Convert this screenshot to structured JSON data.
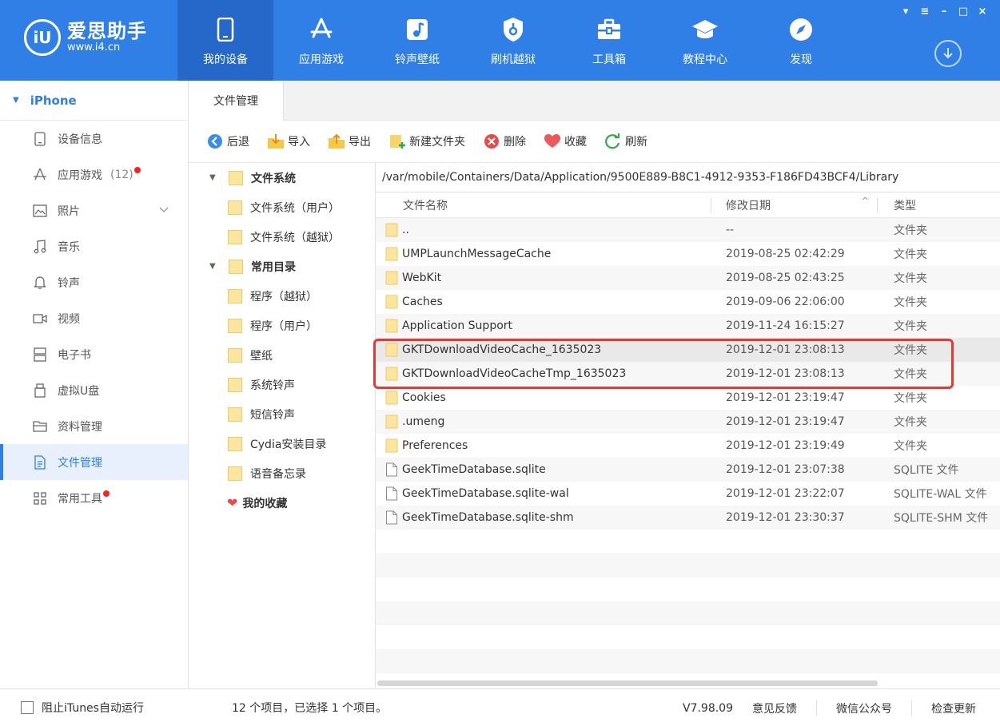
{
  "app": {
    "logo_mark": "iU",
    "name": "爱思助手",
    "url": "www.i4.cn",
    "accent": "#2f7fe6"
  },
  "nav": [
    {
      "label": "我的设备",
      "icon": "phone-icon"
    },
    {
      "label": "应用游戏",
      "icon": "appstore-icon"
    },
    {
      "label": "铃声壁纸",
      "icon": "music-note-icon"
    },
    {
      "label": "刷机越狱",
      "icon": "shield-icon"
    },
    {
      "label": "工具箱",
      "icon": "toolbox-icon"
    },
    {
      "label": "教程中心",
      "icon": "graduation-cap-icon"
    },
    {
      "label": "发现",
      "icon": "compass-icon"
    }
  ],
  "window_controls": [
    "▾",
    "≡",
    "–",
    "□",
    "×"
  ],
  "sidebar": {
    "device": "iPhone",
    "items": [
      {
        "label": "设备信息",
        "icon": "device-info-icon"
      },
      {
        "label": "应用游戏",
        "icon": "appstore-icon",
        "count": "(12)",
        "dot": true
      },
      {
        "label": "照片",
        "icon": "photo-icon",
        "expandable": true
      },
      {
        "label": "音乐",
        "icon": "music-icon"
      },
      {
        "label": "铃声",
        "icon": "bell-icon"
      },
      {
        "label": "视频",
        "icon": "video-icon"
      },
      {
        "label": "电子书",
        "icon": "book-icon"
      },
      {
        "label": "虚拟U盘",
        "icon": "usb-icon"
      },
      {
        "label": "资料管理",
        "icon": "folder-icon"
      },
      {
        "label": "文件管理",
        "icon": "file-icon",
        "active": true
      },
      {
        "label": "常用工具",
        "icon": "grid-icon",
        "dot": true
      }
    ]
  },
  "tab": {
    "label": "文件管理"
  },
  "toolbar": {
    "back": "后退",
    "import": "导入",
    "export": "导出",
    "new_folder": "新建文件夹",
    "delete": "删除",
    "favorite": "收藏",
    "refresh": "刷新"
  },
  "tree": {
    "fs_group": "文件系统",
    "fs_user": "文件系统（用户）",
    "fs_jb": "文件系统（越狱）",
    "common_group": "常用目录",
    "common": [
      "程序（越狱）",
      "程序（用户）",
      "壁纸",
      "系统铃声",
      "短信铃声",
      "Cydia安装目录",
      "语音备忘录"
    ],
    "favorites": "我的收藏"
  },
  "path": "/var/mobile/Containers/Data/Application/9500E889-B8C1-4912-9353-F186FD43BCF4/Library",
  "columns": {
    "name": "文件名称",
    "date": "修改日期",
    "type": "类型"
  },
  "files": [
    {
      "name": "..",
      "date": "--",
      "type": "文件夹",
      "kind": "folder"
    },
    {
      "name": "UMPLaunchMessageCache",
      "date": "2019-08-25 02:42:29",
      "type": "文件夹",
      "kind": "folder"
    },
    {
      "name": "WebKit",
      "date": "2019-08-25 02:43:25",
      "type": "文件夹",
      "kind": "folder"
    },
    {
      "name": "Caches",
      "date": "2019-09-06 22:06:00",
      "type": "文件夹",
      "kind": "folder"
    },
    {
      "name": "Application Support",
      "date": "2019-11-24 16:15:27",
      "type": "文件夹",
      "kind": "folder"
    },
    {
      "name": "GKTDownloadVideoCache_1635023",
      "date": "2019-12-01 23:08:13",
      "type": "文件夹",
      "kind": "folder",
      "selected": true
    },
    {
      "name": "GKTDownloadVideoCacheTmp_1635023",
      "date": "2019-12-01 23:08:13",
      "type": "文件夹",
      "kind": "folder"
    },
    {
      "name": "Cookies",
      "date": "2019-12-01 23:19:47",
      "type": "文件夹",
      "kind": "folder"
    },
    {
      "name": ".umeng",
      "date": "2019-12-01 23:19:47",
      "type": "文件夹",
      "kind": "folder"
    },
    {
      "name": "Preferences",
      "date": "2019-12-01 23:19:49",
      "type": "文件夹",
      "kind": "folder"
    },
    {
      "name": "GeekTimeDatabase.sqlite",
      "date": "2019-12-01 23:07:38",
      "type": "SQLITE 文件",
      "kind": "file"
    },
    {
      "name": "GeekTimeDatabase.sqlite-wal",
      "date": "2019-12-01 23:22:07",
      "type": "SQLITE-WAL 文件",
      "kind": "file"
    },
    {
      "name": "GeekTimeDatabase.sqlite-shm",
      "date": "2019-12-01 23:30:37",
      "type": "SQLITE-SHM 文件",
      "kind": "file"
    }
  ],
  "status": {
    "itunes_checkbox": "阻止iTunes自动运行",
    "summary": "12 个项目，已选择 1 个项目。",
    "version": "V7.98.09",
    "feedback": "意见反馈",
    "wechat": "微信公众号",
    "update": "检查更新"
  }
}
